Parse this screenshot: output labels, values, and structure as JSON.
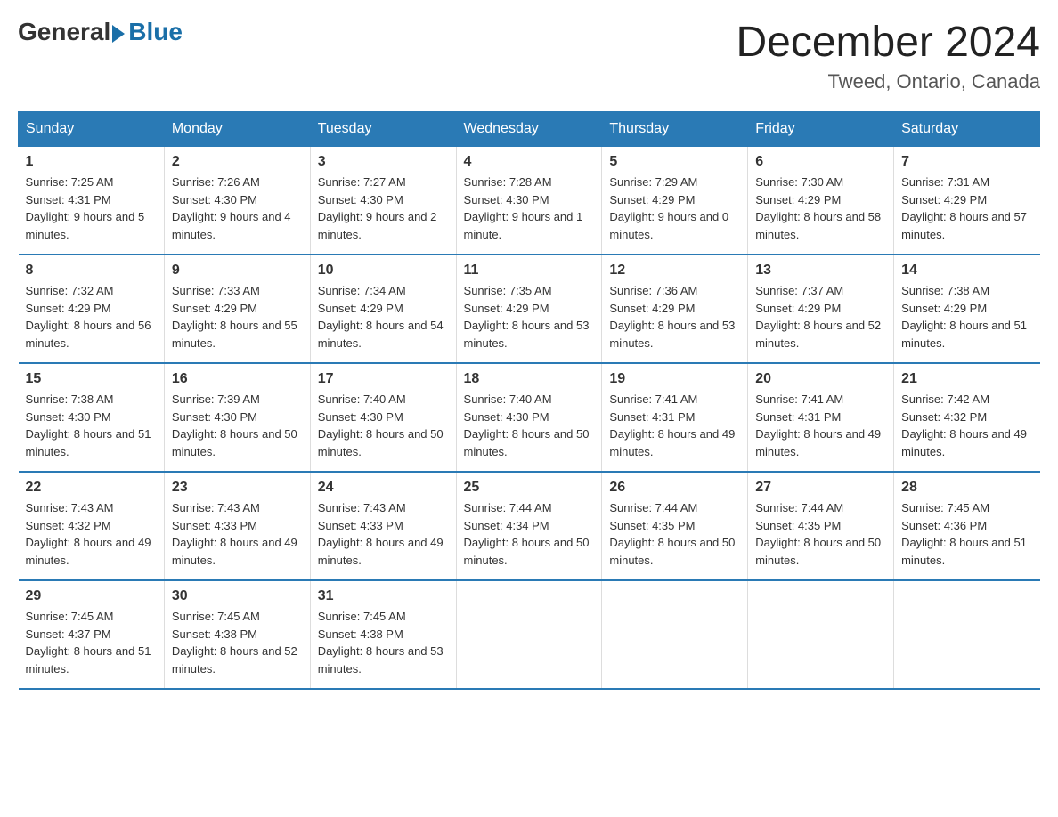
{
  "logo": {
    "general": "General",
    "blue": "Blue"
  },
  "title": "December 2024",
  "location": "Tweed, Ontario, Canada",
  "headers": [
    "Sunday",
    "Monday",
    "Tuesday",
    "Wednesday",
    "Thursday",
    "Friday",
    "Saturday"
  ],
  "weeks": [
    [
      {
        "day": "1",
        "sunrise": "7:25 AM",
        "sunset": "4:31 PM",
        "daylight": "9 hours and 5 minutes."
      },
      {
        "day": "2",
        "sunrise": "7:26 AM",
        "sunset": "4:30 PM",
        "daylight": "9 hours and 4 minutes."
      },
      {
        "day": "3",
        "sunrise": "7:27 AM",
        "sunset": "4:30 PM",
        "daylight": "9 hours and 2 minutes."
      },
      {
        "day": "4",
        "sunrise": "7:28 AM",
        "sunset": "4:30 PM",
        "daylight": "9 hours and 1 minute."
      },
      {
        "day": "5",
        "sunrise": "7:29 AM",
        "sunset": "4:29 PM",
        "daylight": "9 hours and 0 minutes."
      },
      {
        "day": "6",
        "sunrise": "7:30 AM",
        "sunset": "4:29 PM",
        "daylight": "8 hours and 58 minutes."
      },
      {
        "day": "7",
        "sunrise": "7:31 AM",
        "sunset": "4:29 PM",
        "daylight": "8 hours and 57 minutes."
      }
    ],
    [
      {
        "day": "8",
        "sunrise": "7:32 AM",
        "sunset": "4:29 PM",
        "daylight": "8 hours and 56 minutes."
      },
      {
        "day": "9",
        "sunrise": "7:33 AM",
        "sunset": "4:29 PM",
        "daylight": "8 hours and 55 minutes."
      },
      {
        "day": "10",
        "sunrise": "7:34 AM",
        "sunset": "4:29 PM",
        "daylight": "8 hours and 54 minutes."
      },
      {
        "day": "11",
        "sunrise": "7:35 AM",
        "sunset": "4:29 PM",
        "daylight": "8 hours and 53 minutes."
      },
      {
        "day": "12",
        "sunrise": "7:36 AM",
        "sunset": "4:29 PM",
        "daylight": "8 hours and 53 minutes."
      },
      {
        "day": "13",
        "sunrise": "7:37 AM",
        "sunset": "4:29 PM",
        "daylight": "8 hours and 52 minutes."
      },
      {
        "day": "14",
        "sunrise": "7:38 AM",
        "sunset": "4:29 PM",
        "daylight": "8 hours and 51 minutes."
      }
    ],
    [
      {
        "day": "15",
        "sunrise": "7:38 AM",
        "sunset": "4:30 PM",
        "daylight": "8 hours and 51 minutes."
      },
      {
        "day": "16",
        "sunrise": "7:39 AM",
        "sunset": "4:30 PM",
        "daylight": "8 hours and 50 minutes."
      },
      {
        "day": "17",
        "sunrise": "7:40 AM",
        "sunset": "4:30 PM",
        "daylight": "8 hours and 50 minutes."
      },
      {
        "day": "18",
        "sunrise": "7:40 AM",
        "sunset": "4:30 PM",
        "daylight": "8 hours and 50 minutes."
      },
      {
        "day": "19",
        "sunrise": "7:41 AM",
        "sunset": "4:31 PM",
        "daylight": "8 hours and 49 minutes."
      },
      {
        "day": "20",
        "sunrise": "7:41 AM",
        "sunset": "4:31 PM",
        "daylight": "8 hours and 49 minutes."
      },
      {
        "day": "21",
        "sunrise": "7:42 AM",
        "sunset": "4:32 PM",
        "daylight": "8 hours and 49 minutes."
      }
    ],
    [
      {
        "day": "22",
        "sunrise": "7:43 AM",
        "sunset": "4:32 PM",
        "daylight": "8 hours and 49 minutes."
      },
      {
        "day": "23",
        "sunrise": "7:43 AM",
        "sunset": "4:33 PM",
        "daylight": "8 hours and 49 minutes."
      },
      {
        "day": "24",
        "sunrise": "7:43 AM",
        "sunset": "4:33 PM",
        "daylight": "8 hours and 49 minutes."
      },
      {
        "day": "25",
        "sunrise": "7:44 AM",
        "sunset": "4:34 PM",
        "daylight": "8 hours and 50 minutes."
      },
      {
        "day": "26",
        "sunrise": "7:44 AM",
        "sunset": "4:35 PM",
        "daylight": "8 hours and 50 minutes."
      },
      {
        "day": "27",
        "sunrise": "7:44 AM",
        "sunset": "4:35 PM",
        "daylight": "8 hours and 50 minutes."
      },
      {
        "day": "28",
        "sunrise": "7:45 AM",
        "sunset": "4:36 PM",
        "daylight": "8 hours and 51 minutes."
      }
    ],
    [
      {
        "day": "29",
        "sunrise": "7:45 AM",
        "sunset": "4:37 PM",
        "daylight": "8 hours and 51 minutes."
      },
      {
        "day": "30",
        "sunrise": "7:45 AM",
        "sunset": "4:38 PM",
        "daylight": "8 hours and 52 minutes."
      },
      {
        "day": "31",
        "sunrise": "7:45 AM",
        "sunset": "4:38 PM",
        "daylight": "8 hours and 53 minutes."
      },
      null,
      null,
      null,
      null
    ]
  ]
}
